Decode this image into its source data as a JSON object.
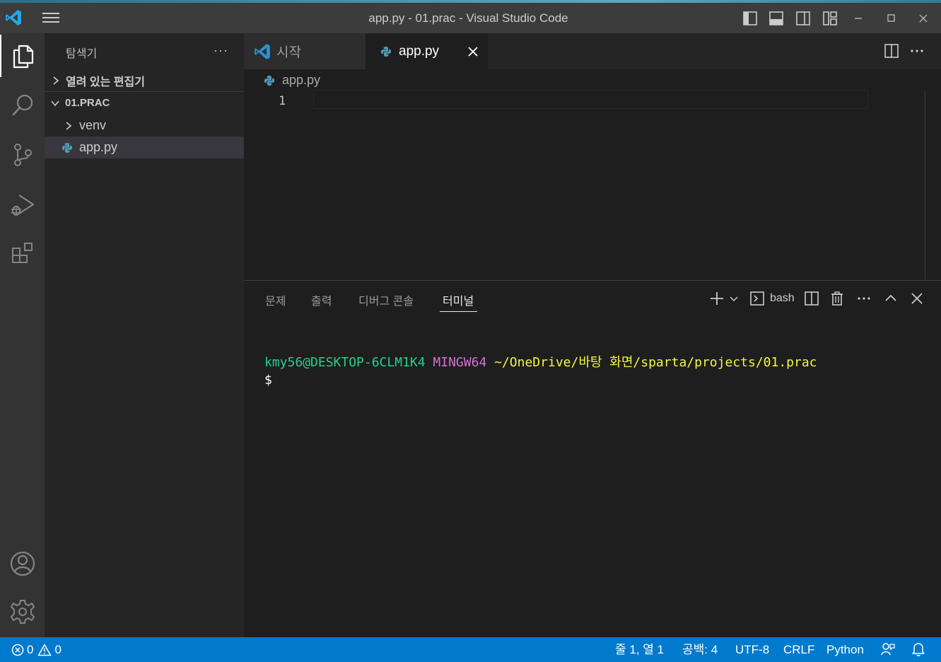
{
  "titlebar": {
    "title": "app.py - 01.prac - Visual Studio Code"
  },
  "sidebar": {
    "title": "탐색기",
    "more": "···",
    "open_editors": "열려 있는 편집기",
    "folder": "01.PRAC",
    "items": [
      {
        "label": "venv"
      },
      {
        "label": "app.py"
      }
    ]
  },
  "tabs": [
    {
      "label": "시작"
    },
    {
      "label": "app.py"
    }
  ],
  "editor": {
    "breadcrumb": "app.py",
    "line_number": "1"
  },
  "panel": {
    "tabs": [
      {
        "label": "문제"
      },
      {
        "label": "출력"
      },
      {
        "label": "디버그 콘솔"
      },
      {
        "label": "터미널"
      }
    ],
    "terminal_shell": "bash",
    "more": "···"
  },
  "terminal": {
    "user_host": "kmy56@DESKTOP-6CLM1K4",
    "env": "MINGW64",
    "path_a": "~/OneDrive/",
    "path_b": "바탕 화면",
    "path_c": "/sparta/projects/01.prac",
    "prompt": "$"
  },
  "statusbar": {
    "errors": "0",
    "warnings": "0",
    "position": "줄 1, 열 1",
    "spaces": "공백: 4",
    "encoding": "UTF-8",
    "eol": "CRLF",
    "language": "Python"
  },
  "colors": {
    "accent": "#007acc",
    "terminal_green": "#23d18b",
    "terminal_magenta": "#d670d6",
    "terminal_yellow": "#f5f543",
    "python_blue": "#519aba"
  }
}
